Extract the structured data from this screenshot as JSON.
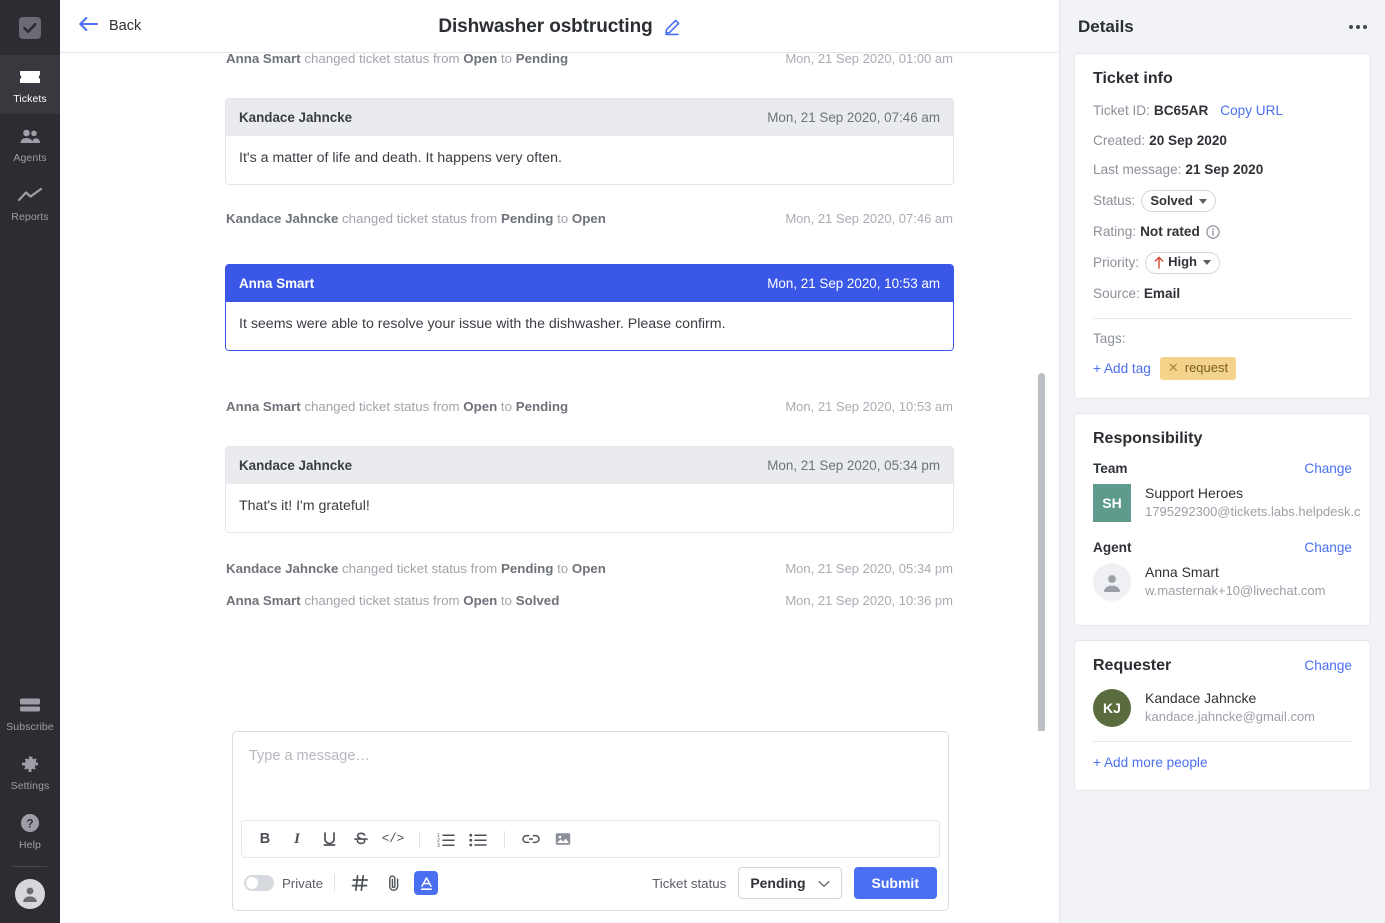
{
  "nav": {
    "logo_icon": "checkbox-logo-icon",
    "items": [
      {
        "label": "Tickets",
        "icon": "ticket-icon",
        "active": true
      },
      {
        "label": "Agents",
        "icon": "agents-icon",
        "active": false
      },
      {
        "label": "Reports",
        "icon": "reports-chart-icon",
        "active": false
      }
    ],
    "bottom_items": [
      {
        "label": "Subscribe",
        "icon": "card-icon"
      },
      {
        "label": "Settings",
        "icon": "gear-icon"
      },
      {
        "label": "Help",
        "icon": "question-circle-icon"
      }
    ],
    "avatar_icon": "user-avatar-icon"
  },
  "topbar": {
    "back_label": "Back",
    "back_icon": "arrow-left-icon",
    "ticket_title": "Dishwasher osbtructing",
    "edit_icon": "pencil-edit-icon"
  },
  "thread": {
    "entries": [
      {
        "kind": "log",
        "who": "Anna Smart",
        "text_before": " changed ticket status from ",
        "from": "Open",
        "to_word": " to ",
        "to": "Pending",
        "when": "Mon, 21 Sep 2020, 01:00 am"
      },
      {
        "kind": "message",
        "side": "customer",
        "name": "Kandace Jahncke",
        "when": "Mon, 21 Sep 2020, 07:46 am",
        "body": "It's a matter of life and death. It happens very often."
      },
      {
        "kind": "log",
        "who": "Kandace Jahncke",
        "text_before": " changed ticket status from ",
        "from": "Pending",
        "to_word": " to ",
        "to": "Open",
        "when": "Mon, 21 Sep 2020, 07:46 am"
      },
      {
        "kind": "message",
        "side": "agent",
        "name": "Anna Smart",
        "when": "Mon, 21 Sep 2020, 10:53 am",
        "body": "It seems were able to resolve your issue with the dishwasher. Please confirm."
      },
      {
        "kind": "log",
        "who": "Anna Smart",
        "text_before": " changed ticket status from ",
        "from": "Open",
        "to_word": " to ",
        "to": "Pending",
        "when": "Mon, 21 Sep 2020, 10:53 am"
      },
      {
        "kind": "message",
        "side": "customer",
        "name": "Kandace Jahncke",
        "when": "Mon, 21 Sep 2020, 05:34 pm",
        "body": "That's it! I'm grateful!"
      },
      {
        "kind": "log",
        "who": "Kandace Jahncke",
        "text_before": " changed ticket status from ",
        "from": "Pending",
        "to_word": " to ",
        "to": "Open",
        "when": "Mon, 21 Sep 2020, 05:34 pm"
      },
      {
        "kind": "log",
        "who": "Anna Smart",
        "text_before": " changed ticket status from ",
        "from": "Open",
        "to_word": " to ",
        "to": "Solved",
        "when": "Mon, 21 Sep 2020, 10:36 pm"
      }
    ]
  },
  "composer": {
    "placeholder": "Type a message…",
    "value": "",
    "format_buttons": [
      {
        "name": "bold-icon",
        "glyph": "B"
      },
      {
        "name": "italic-icon",
        "glyph": "I"
      },
      {
        "name": "underline-icon",
        "glyph": "U"
      },
      {
        "name": "strikethrough-icon",
        "glyph": "S"
      },
      {
        "name": "code-icon",
        "glyph": "</>"
      },
      {
        "name": "ordered-list-icon",
        "glyph": ""
      },
      {
        "name": "bullet-list-icon",
        "glyph": ""
      },
      {
        "name": "link-icon",
        "glyph": ""
      },
      {
        "name": "image-icon",
        "glyph": ""
      }
    ],
    "private_label": "Private",
    "private_on": false,
    "hash_icon": "hashtag-icon",
    "attach_icon": "paperclip-icon",
    "text_format_icon": "text-color-icon",
    "ticket_status_label": "Ticket status",
    "ticket_status_value": "Pending",
    "submit_label": "Submit"
  },
  "details": {
    "title": "Details",
    "more_icon": "more-options-icon",
    "ticket_info": {
      "title": "Ticket info",
      "ticket_id_label": "Ticket ID:",
      "ticket_id_value": "BC65AR",
      "copy_url_label": "Copy URL",
      "created_label": "Created:",
      "created_value": "20 Sep 2020",
      "last_message_label": "Last message:",
      "last_message_value": "21 Sep 2020",
      "status_label": "Status:",
      "status_value": "Solved",
      "rating_label": "Rating:",
      "rating_value": "Not rated",
      "rating_info_icon": "info-circle-icon",
      "priority_label": "Priority:",
      "priority_value": "High",
      "priority_icon": "arrow-up-icon",
      "source_label": "Source:",
      "source_value": "Email",
      "tags_label": "Tags:",
      "add_tag_label": "+ Add tag",
      "tags": [
        {
          "label": "request",
          "remove_icon": "close-x-icon"
        }
      ]
    },
    "responsibility": {
      "title": "Responsibility",
      "team_label": "Team",
      "team_change_label": "Change",
      "team_initials": "SH",
      "team_name": "Support Heroes",
      "team_email": "1795292300@tickets.labs.helpdesk.c",
      "agent_label": "Agent",
      "agent_change_label": "Change",
      "agent_name": "Anna Smart",
      "agent_email": "w.masternak+10@livechat.com",
      "agent_avatar_icon": "user-avatar-icon"
    },
    "requester": {
      "title": "Requester",
      "change_label": "Change",
      "initials": "KJ",
      "name": "Kandace Jahncke",
      "email": "kandace.jahncke@gmail.com",
      "add_people_label": "+ Add more people"
    }
  },
  "colors": {
    "accent_blue": "#4a6ff0",
    "agent_message_blue": "#3b57e8",
    "nav_dark": "#2f2b32",
    "tag_amber": "#f3d48a",
    "team_avatar_teal": "#5f9b8c",
    "requester_avatar_olive": "#5a6b3e",
    "priority_arrow_red": "#d9533c"
  }
}
